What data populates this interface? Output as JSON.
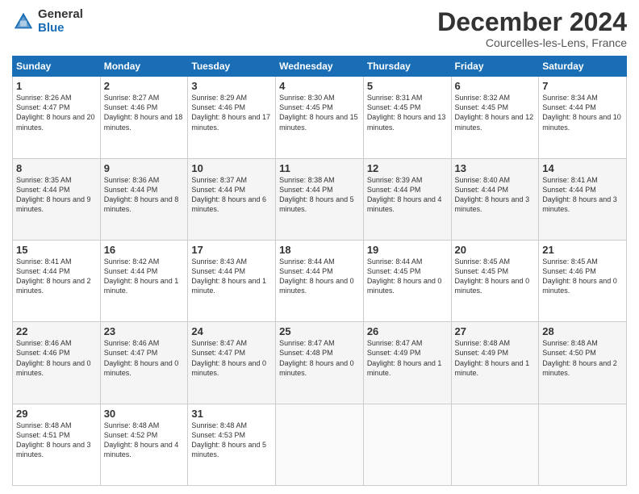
{
  "logo": {
    "general": "General",
    "blue": "Blue"
  },
  "title": "December 2024",
  "location": "Courcelles-les-Lens, France",
  "days_header": [
    "Sunday",
    "Monday",
    "Tuesday",
    "Wednesday",
    "Thursday",
    "Friday",
    "Saturday"
  ],
  "weeks": [
    [
      {
        "day": "1",
        "sunrise": "8:26 AM",
        "sunset": "4:47 PM",
        "daylight": "8 hours and 20 minutes."
      },
      {
        "day": "2",
        "sunrise": "8:27 AM",
        "sunset": "4:46 PM",
        "daylight": "8 hours and 18 minutes."
      },
      {
        "day": "3",
        "sunrise": "8:29 AM",
        "sunset": "4:46 PM",
        "daylight": "8 hours and 17 minutes."
      },
      {
        "day": "4",
        "sunrise": "8:30 AM",
        "sunset": "4:45 PM",
        "daylight": "8 hours and 15 minutes."
      },
      {
        "day": "5",
        "sunrise": "8:31 AM",
        "sunset": "4:45 PM",
        "daylight": "8 hours and 13 minutes."
      },
      {
        "day": "6",
        "sunrise": "8:32 AM",
        "sunset": "4:45 PM",
        "daylight": "8 hours and 12 minutes."
      },
      {
        "day": "7",
        "sunrise": "8:34 AM",
        "sunset": "4:44 PM",
        "daylight": "8 hours and 10 minutes."
      }
    ],
    [
      {
        "day": "8",
        "sunrise": "8:35 AM",
        "sunset": "4:44 PM",
        "daylight": "8 hours and 9 minutes."
      },
      {
        "day": "9",
        "sunrise": "8:36 AM",
        "sunset": "4:44 PM",
        "daylight": "8 hours and 8 minutes."
      },
      {
        "day": "10",
        "sunrise": "8:37 AM",
        "sunset": "4:44 PM",
        "daylight": "8 hours and 6 minutes."
      },
      {
        "day": "11",
        "sunrise": "8:38 AM",
        "sunset": "4:44 PM",
        "daylight": "8 hours and 5 minutes."
      },
      {
        "day": "12",
        "sunrise": "8:39 AM",
        "sunset": "4:44 PM",
        "daylight": "8 hours and 4 minutes."
      },
      {
        "day": "13",
        "sunrise": "8:40 AM",
        "sunset": "4:44 PM",
        "daylight": "8 hours and 3 minutes."
      },
      {
        "day": "14",
        "sunrise": "8:41 AM",
        "sunset": "4:44 PM",
        "daylight": "8 hours and 3 minutes."
      }
    ],
    [
      {
        "day": "15",
        "sunrise": "8:41 AM",
        "sunset": "4:44 PM",
        "daylight": "8 hours and 2 minutes."
      },
      {
        "day": "16",
        "sunrise": "8:42 AM",
        "sunset": "4:44 PM",
        "daylight": "8 hours and 1 minute."
      },
      {
        "day": "17",
        "sunrise": "8:43 AM",
        "sunset": "4:44 PM",
        "daylight": "8 hours and 1 minute."
      },
      {
        "day": "18",
        "sunrise": "8:44 AM",
        "sunset": "4:44 PM",
        "daylight": "8 hours and 0 minutes."
      },
      {
        "day": "19",
        "sunrise": "8:44 AM",
        "sunset": "4:45 PM",
        "daylight": "8 hours and 0 minutes."
      },
      {
        "day": "20",
        "sunrise": "8:45 AM",
        "sunset": "4:45 PM",
        "daylight": "8 hours and 0 minutes."
      },
      {
        "day": "21",
        "sunrise": "8:45 AM",
        "sunset": "4:46 PM",
        "daylight": "8 hours and 0 minutes."
      }
    ],
    [
      {
        "day": "22",
        "sunrise": "8:46 AM",
        "sunset": "4:46 PM",
        "daylight": "8 hours and 0 minutes."
      },
      {
        "day": "23",
        "sunrise": "8:46 AM",
        "sunset": "4:47 PM",
        "daylight": "8 hours and 0 minutes."
      },
      {
        "day": "24",
        "sunrise": "8:47 AM",
        "sunset": "4:47 PM",
        "daylight": "8 hours and 0 minutes."
      },
      {
        "day": "25",
        "sunrise": "8:47 AM",
        "sunset": "4:48 PM",
        "daylight": "8 hours and 0 minutes."
      },
      {
        "day": "26",
        "sunrise": "8:47 AM",
        "sunset": "4:49 PM",
        "daylight": "8 hours and 1 minute."
      },
      {
        "day": "27",
        "sunrise": "8:48 AM",
        "sunset": "4:49 PM",
        "daylight": "8 hours and 1 minute."
      },
      {
        "day": "28",
        "sunrise": "8:48 AM",
        "sunset": "4:50 PM",
        "daylight": "8 hours and 2 minutes."
      }
    ],
    [
      {
        "day": "29",
        "sunrise": "8:48 AM",
        "sunset": "4:51 PM",
        "daylight": "8 hours and 3 minutes."
      },
      {
        "day": "30",
        "sunrise": "8:48 AM",
        "sunset": "4:52 PM",
        "daylight": "8 hours and 4 minutes."
      },
      {
        "day": "31",
        "sunrise": "8:48 AM",
        "sunset": "4:53 PM",
        "daylight": "8 hours and 5 minutes."
      },
      null,
      null,
      null,
      null
    ]
  ]
}
